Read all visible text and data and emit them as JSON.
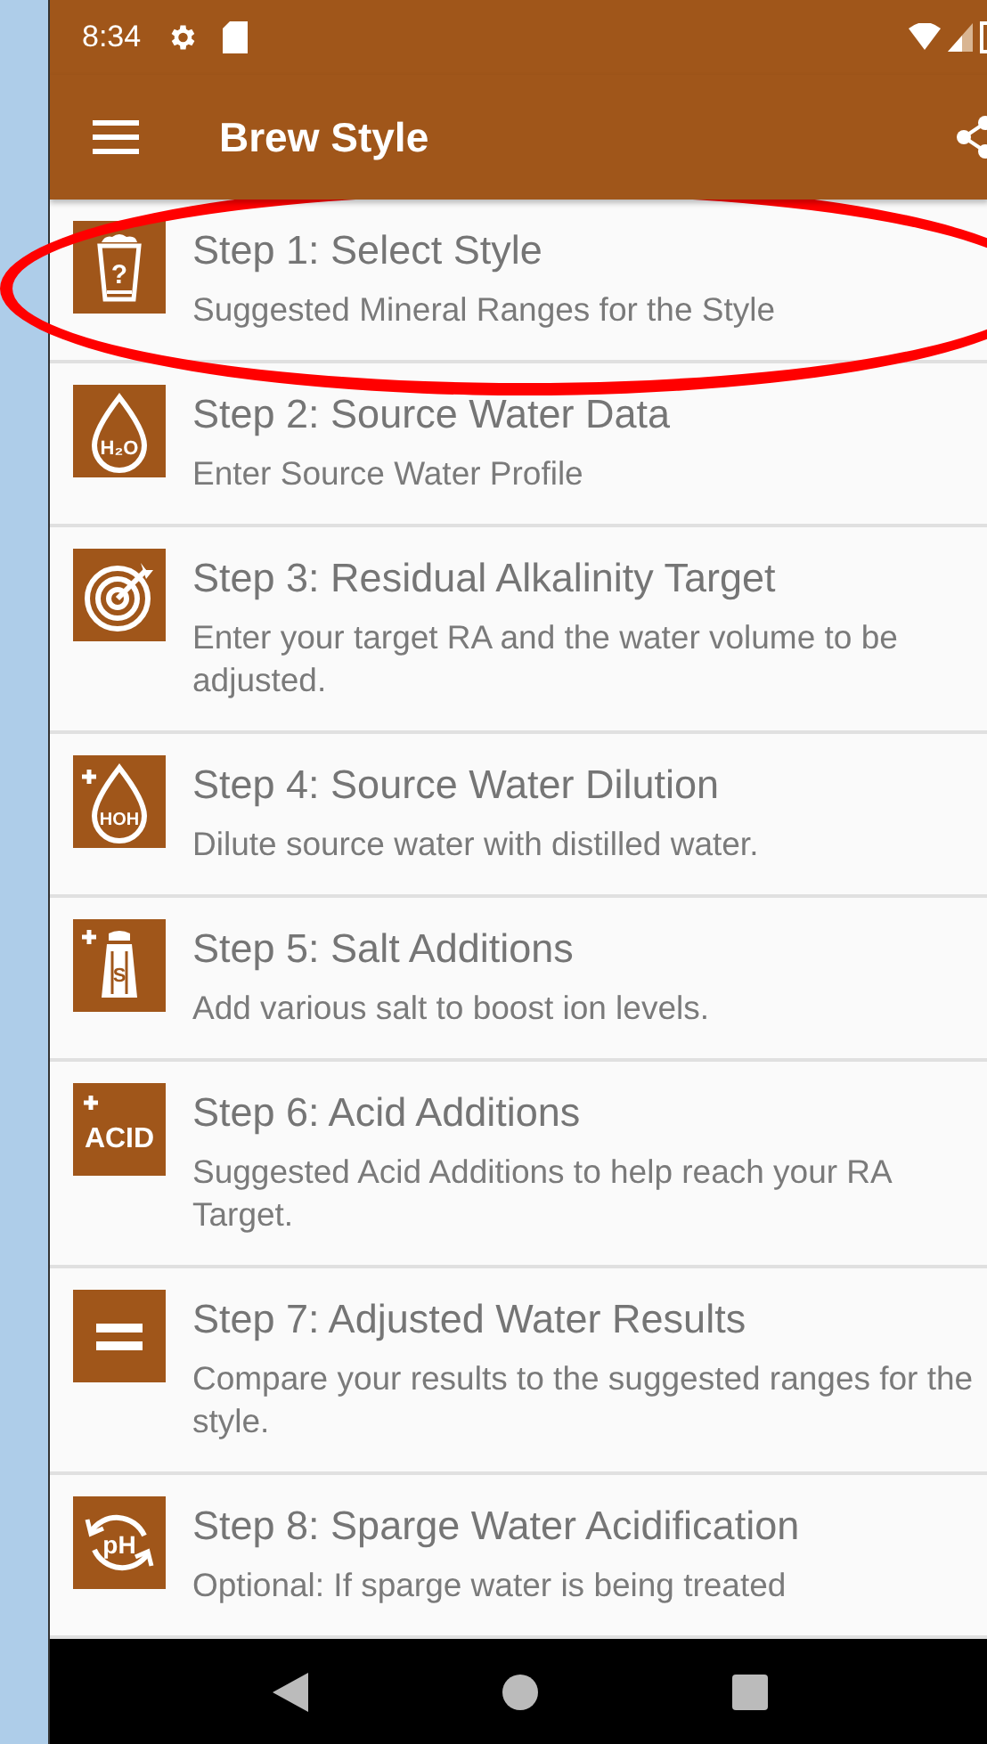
{
  "status_bar": {
    "time": "8:34"
  },
  "app_bar": {
    "title": "Brew Style"
  },
  "steps": [
    {
      "kind": "cup",
      "icon_text": "?",
      "title": "Step 1: Select Style",
      "subtitle": "Suggested Mineral Ranges for the Style",
      "circled": true
    },
    {
      "kind": "drop",
      "icon_text": "H₂O",
      "title": "Step 2: Source Water Data",
      "subtitle": "Enter Source Water Profile",
      "circled": false
    },
    {
      "kind": "target",
      "title": "Step 3: Residual Alkalinity Target",
      "subtitle": "Enter your target RA and the water volume to be adjusted.",
      "circled": false
    },
    {
      "kind": "drop-plus",
      "icon_text": "HOH",
      "title": "Step 4: Source Water Dilution",
      "subtitle": "Dilute source water with distilled water.",
      "circled": false
    },
    {
      "kind": "shaker",
      "icon_text": "S",
      "title": "Step 5: Salt Additions",
      "subtitle": "Add various salt to boost ion levels.",
      "circled": false
    },
    {
      "kind": "acid",
      "icon_text": "ACID",
      "title": "Step 6: Acid Additions",
      "subtitle": "Suggested Acid Additions to help reach your RA Target.",
      "circled": false
    },
    {
      "kind": "equals",
      "title": "Step 7: Adjusted Water Results",
      "subtitle": "Compare your results to the suggested ranges for the style.",
      "circled": false
    },
    {
      "kind": "cycle",
      "icon_text": "pH",
      "title": "Step 8: Sparge Water Acidification",
      "subtitle": "Optional: If sparge water is being treated",
      "circled": false
    }
  ]
}
